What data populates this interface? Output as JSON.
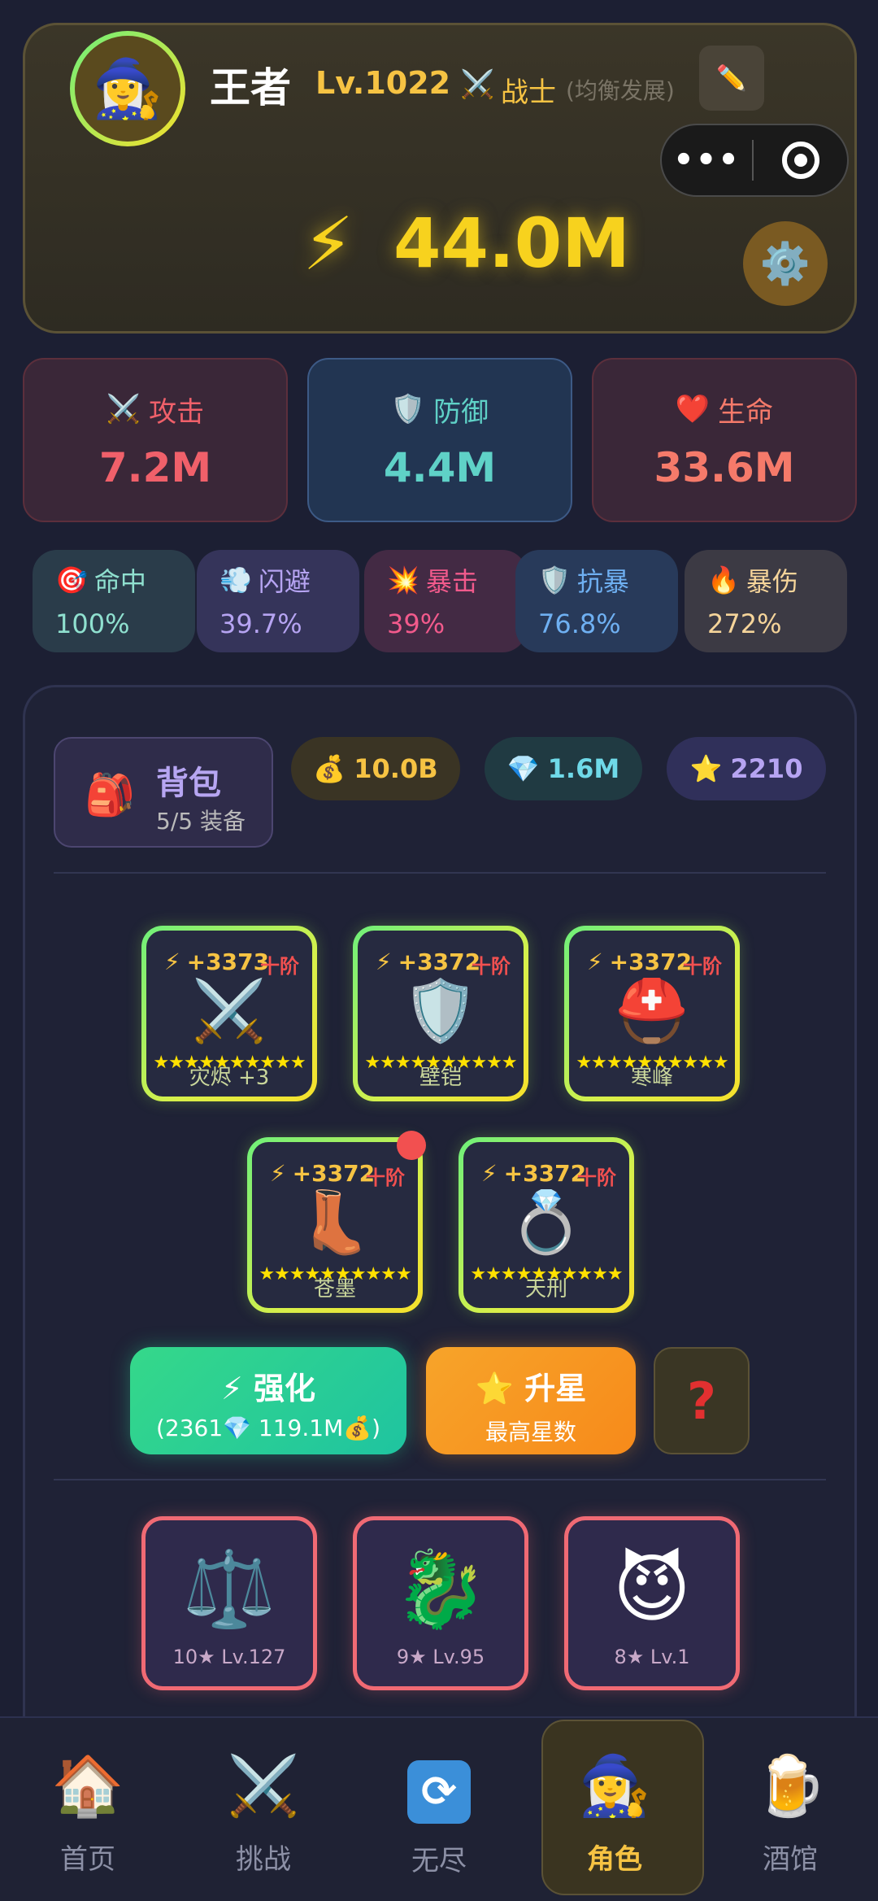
{
  "header": {
    "avatar_icon": "🧙‍♀️",
    "name": "王者",
    "level": "Lv.1022",
    "class_icon": "⚔️",
    "class_name": "战士",
    "class_sub": "(均衡发展)",
    "edit_icon": "✏️",
    "capsule_more": "•••",
    "power_icon": "⚡",
    "power": "44.0M",
    "settings_icon": "⚙️"
  },
  "stats": {
    "attack": {
      "icon": "⚔️",
      "label": "攻击",
      "value": "7.2M"
    },
    "defense": {
      "icon": "🛡️",
      "label": "防御",
      "value": "4.4M"
    },
    "health": {
      "icon": "❤️",
      "label": "生命",
      "value": "33.6M"
    }
  },
  "substats": [
    {
      "icon": "🎯",
      "label": "命中",
      "value": "100%"
    },
    {
      "icon": "💨",
      "label": "闪避",
      "value": "39.7%"
    },
    {
      "icon": "💥",
      "label": "暴击",
      "value": "39%"
    },
    {
      "icon": "🛡️",
      "label": "抗暴",
      "value": "76.8%"
    },
    {
      "icon": "🔥",
      "label": "暴伤",
      "value": "272%"
    }
  ],
  "bag": {
    "icon": "🎒",
    "title": "背包",
    "subtitle": "5/5 装备"
  },
  "currency": {
    "gold": {
      "icon": "💰",
      "value": "10.0B"
    },
    "gem": {
      "icon": "💎",
      "value": "1.6M"
    },
    "star": {
      "icon": "⭐",
      "value": "2210"
    }
  },
  "equipment": [
    {
      "power": "+3373",
      "tier": "十阶",
      "icon": "⚔️",
      "stars": "★★★★★★★★★★",
      "name": "灾烬 +3"
    },
    {
      "power": "+3372",
      "tier": "十阶",
      "icon": "🛡️",
      "stars": "★★★★★★★★★★",
      "name": "壁铠"
    },
    {
      "power": "+3372",
      "tier": "十阶",
      "icon": "⛑️",
      "stars": "★★★★★★★★★★",
      "name": "寒峰"
    },
    {
      "power": "+3372",
      "tier": "十阶",
      "icon": "👢",
      "stars": "★★★★★★★★★★",
      "name": "苍墨"
    },
    {
      "power": "+3372",
      "tier": "十阶",
      "icon": "💍",
      "stars": "★★★★★★★★★★",
      "name": "天刑"
    }
  ],
  "actions": {
    "enhance_icon": "⚡",
    "enhance_label": "强化",
    "enhance_cost": "(2361💎 119.1M💰)",
    "star_icon": "⭐",
    "star_label": "升星",
    "star_sub": "最高星数",
    "help_label": "?"
  },
  "pets": [
    {
      "icon": "⚖️",
      "info": "10★ Lv.127"
    },
    {
      "icon": "🐉",
      "info": "9★ Lv.95"
    },
    {
      "icon": "😈",
      "info": "8★ Lv.1"
    }
  ],
  "nav": [
    {
      "icon": "🏠",
      "label": "首页"
    },
    {
      "icon": "⚔️",
      "label": "挑战"
    },
    {
      "icon": "🔄",
      "label": "无尽"
    },
    {
      "icon": "🧙‍♀️",
      "label": "角色"
    },
    {
      "icon": "🍺",
      "label": "酒馆"
    }
  ],
  "colors": {
    "accent_gold": "#f6c343",
    "enhance_green": "#35d88a",
    "star_orange": "#f7a42a",
    "pet_border": "#f06a74"
  }
}
